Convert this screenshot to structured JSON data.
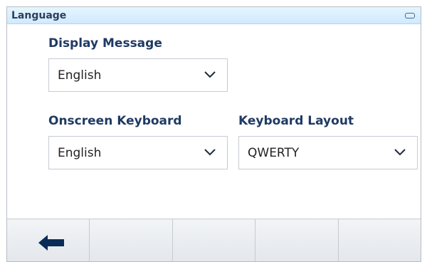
{
  "window": {
    "title": "Language"
  },
  "fields": {
    "display_message": {
      "label": "Display Message",
      "value": "English"
    },
    "onscreen_keyboard": {
      "label": "Onscreen Keyboard",
      "value": "English"
    },
    "keyboard_layout": {
      "label": "Keyboard Layout",
      "value": "QWERTY"
    }
  },
  "softkeys": [
    {
      "icon": "back-arrow-icon"
    },
    {
      "icon": ""
    },
    {
      "icon": ""
    },
    {
      "icon": ""
    },
    {
      "icon": ""
    }
  ],
  "colors": {
    "label": "#1f3a63",
    "titlebar": "#d9f0ff",
    "arrow": "#0b2c57"
  }
}
